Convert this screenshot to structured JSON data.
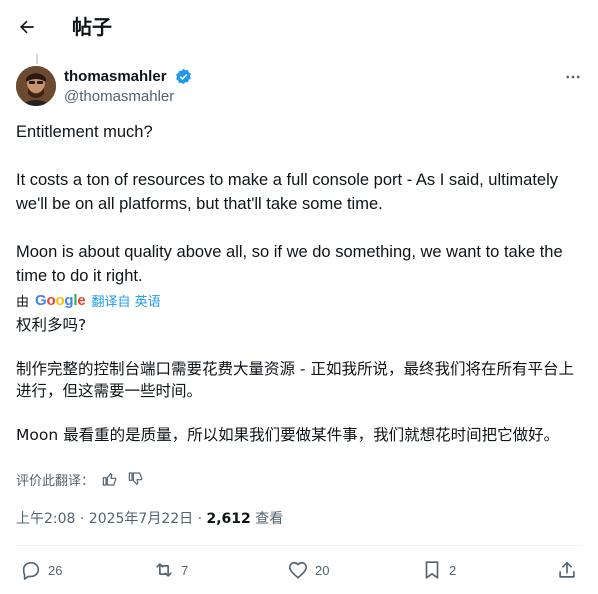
{
  "header": {
    "title": "帖子"
  },
  "author": {
    "name": "thomasmahler",
    "handle": "@thomasmahler"
  },
  "tweet": {
    "text": "Entitlement much?\n\nIt costs a ton of resources to make a full console port - As I said, ultimately we'll be on all platforms, but that'll take some time.\n\nMoon is about quality above all, so if we do something, we want to take the time to do it right."
  },
  "translation": {
    "by": "由",
    "google": "Google",
    "link_label": "翻译自 英语",
    "text": "权利多吗?\n\n制作完整的控制台端口需要花费大量资源 - 正如我所说，最终我们将在所有平台上进行，但这需要一些时间。\n\nMoon 最看重的是质量，所以如果我们要做某件事，我们就想花时间把它做好。",
    "rate_label": "评价此翻译："
  },
  "meta": {
    "time": "上午2:08 · 2025年7月22日 · ",
    "views": "2,612",
    "views_label": " 查看"
  },
  "actions": {
    "replies": "26",
    "reposts": "7",
    "likes": "20",
    "bookmarks": "2"
  },
  "colors": {
    "accent": "#1d9bf0",
    "muted": "#536471",
    "text": "#0f1419"
  }
}
